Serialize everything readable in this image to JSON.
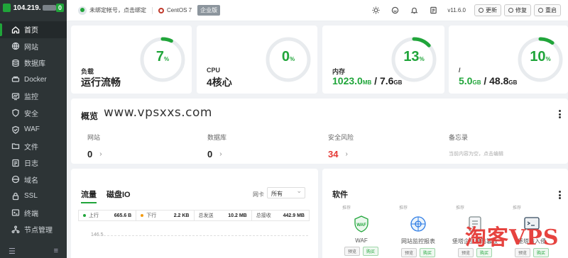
{
  "sidebar": {
    "ip": "104.219.",
    "badge": "0",
    "items": [
      {
        "label": "首页",
        "icon": "home-icon",
        "active": true
      },
      {
        "label": "网站",
        "icon": "globe-icon"
      },
      {
        "label": "数据库",
        "icon": "database-icon"
      },
      {
        "label": "Docker",
        "icon": "docker-icon"
      },
      {
        "label": "监控",
        "icon": "monitor-icon"
      },
      {
        "label": "安全",
        "icon": "shield-icon"
      },
      {
        "label": "WAF",
        "icon": "waf-icon"
      },
      {
        "label": "文件",
        "icon": "folder-icon"
      },
      {
        "label": "日志",
        "icon": "log-icon"
      },
      {
        "label": "域名",
        "icon": "domain-icon"
      },
      {
        "label": "SSL",
        "icon": "ssl-icon"
      },
      {
        "label": "终端",
        "icon": "terminal-icon"
      },
      {
        "label": "节点管理",
        "icon": "nodes-icon"
      }
    ],
    "footer": {
      "left": "☰",
      "right": "≡"
    }
  },
  "topbar": {
    "account": "未绑定帐号，点击绑定",
    "os": "CentOS 7",
    "edition": "企业版",
    "version": "v11.6.0",
    "buttons": {
      "update": "更新",
      "repair": "修复",
      "restart": "重启"
    }
  },
  "stats": [
    {
      "label": "负载",
      "value": "运行流畅",
      "gauge": "7",
      "unit": "%",
      "percent": 7
    },
    {
      "label": "CPU",
      "value": "4核心",
      "gauge": "0",
      "unit": "%",
      "percent": 0
    },
    {
      "label": "内存",
      "used": "1023.0",
      "used_unit": "MB",
      "sep": " / ",
      "total": "7.6",
      "total_unit": "GB",
      "gauge": "13",
      "unit": "%",
      "percent": 13
    },
    {
      "label": "/",
      "used": "5.0",
      "used_unit": "GB",
      "sep": " / ",
      "total": "48.8",
      "total_unit": "GB",
      "gauge": "10",
      "unit": "%",
      "percent": 10
    }
  ],
  "overview": {
    "title": "概览",
    "watermark": "www.vpsxxs.com",
    "cols": [
      {
        "label": "网站",
        "value": "0",
        "chevron": "›"
      },
      {
        "label": "数据库",
        "value": "0",
        "chevron": "›"
      },
      {
        "label": "安全风险",
        "value": "34",
        "chevron": "›"
      },
      {
        "label": "备忘录",
        "sub": "当前内容为空，点击编辑"
      }
    ]
  },
  "traffic": {
    "tabs": [
      "流量",
      "磁盘IO"
    ],
    "nic_label": "网卡",
    "nic_value": "所有",
    "stats": [
      {
        "label": "上行",
        "value": "665.6 B",
        "color": "#20a53a"
      },
      {
        "label": "下行",
        "value": "2.2 KB",
        "color": "#f39c12"
      },
      {
        "label": "总发送",
        "value": "10.2 MB"
      },
      {
        "label": "总接收",
        "value": "442.9 MB"
      }
    ],
    "axis_top": "146.5"
  },
  "software": {
    "title": "软件",
    "items": [
      {
        "tag": "推荐",
        "name": "WAF",
        "preview": "预览",
        "buy": "购买"
      },
      {
        "tag": "推荐",
        "name": "网站监控报表",
        "preview": "预览",
        "buy": "购买"
      },
      {
        "tag": "推荐",
        "name": "堡塔企业级防篡改",
        "preview": "预览",
        "buy": "购买"
      },
      {
        "tag": "推荐",
        "name": "堡塔防入侵",
        "preview": "预览",
        "buy": "购买"
      }
    ]
  },
  "watermark_text": "淘客VPS",
  "colors": {
    "accent": "#20a53a",
    "danger": "#e53935",
    "sidebar": "#2d3436"
  }
}
